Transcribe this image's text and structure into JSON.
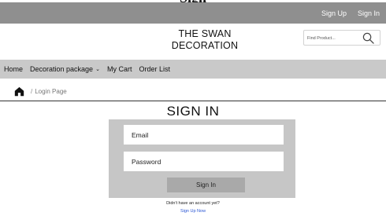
{
  "topbar": {
    "sign_up": "Sign Up",
    "sign_in": "Sign In"
  },
  "header": {
    "logo_line1": "THE SWAN",
    "logo_line2": "DECORATION",
    "search_placeholder": "Find Product...",
    "search_icon": "search-icon"
  },
  "nav": {
    "items": [
      {
        "label": "Home"
      },
      {
        "label": "Decoration package"
      },
      {
        "label": "My Cart"
      },
      {
        "label": "Order List"
      }
    ],
    "dropdown_icon": "chevron-down-icon"
  },
  "breadcrumb": {
    "home_icon": "home-icon",
    "separator": "/",
    "current": "Login Page"
  },
  "signin": {
    "title": "SIGN IN",
    "email_placeholder": "Email",
    "password_placeholder": "Password",
    "button": "Sign In",
    "no_account_text": "Didn't have an account yet?",
    "signup_link": "Sign Up Now"
  },
  "colors": {
    "topbar_bg": "#8f8f8f",
    "nav_bg": "#c9c9c9",
    "form_bg": "#c6c6c6",
    "button_bg": "#a9a9a9",
    "link": "#2b57d4"
  }
}
